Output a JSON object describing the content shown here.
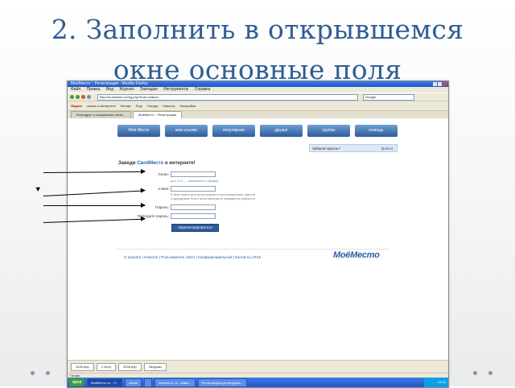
{
  "slide": {
    "title_line1": "2. Заполнить в открывшемся",
    "title_line2": "окне основные поля"
  },
  "browser": {
    "window_title": "МоёМесто :: Регистрация - Mozilla Firefox",
    "menu": [
      "Файл",
      "Правка",
      "Вид",
      "Журнал",
      "Закладки",
      "Инструменты",
      "Справка"
    ],
    "url": "http://moemesto.ru/reg.php?from=bottom",
    "search_placeholder": "Google",
    "toolbar_items": [
      "Яндекс",
      "искать в интернете",
      "Кнопки",
      "Я.ру",
      "Погода",
      "Новости",
      "Настройка"
    ],
    "tabs": [
      "Блогодру» и социальных сетях...",
      "МоёМесто :: Регистрация"
    ]
  },
  "site": {
    "nav": [
      "Моё Место",
      "мои ссылки",
      "популярное",
      "друзья",
      "группы",
      "помощь"
    ],
    "forgot_password": "Забыли пароль?",
    "forgot_link": "[войти]",
    "heading_prefix": "Заведи ",
    "heading_brand": "СвоёМесто",
    "heading_suffix": " в интернете!",
    "labels": {
      "login": "Логин:",
      "email": "e-Mail:",
      "password": "Пароль:",
      "password_repeat": "Повторите пароль:"
    },
    "login_hint": "(a-z, 0-9, _, начинается с буквы)",
    "email_hint_1": "E-Mail нужен для регистрации и восстановления пароля.",
    "email_hint_2": "Содержимое этого поля никогда не выводится публично.",
    "register_button": "Зарегистрироваться",
    "footer": "О проекте  |  Новости  |  Пользователь  |  Блог  |  Конфиденциальный  |  Контакты  |  RSS",
    "logo": "МоёМесто"
  },
  "os": {
    "downloads": [
      "1433.php",
      "1 Истр",
      "2006.php",
      "Загрузки"
    ],
    "status": "Готово",
    "start": "пуск",
    "tasks": [
      "МоёМесто.ru :: Р...",
      "rusnet",
      "",
      "Interest-ru. ru - комм...",
      "Регистрация для продолж..."
    ],
    "clock": "14:33"
  }
}
